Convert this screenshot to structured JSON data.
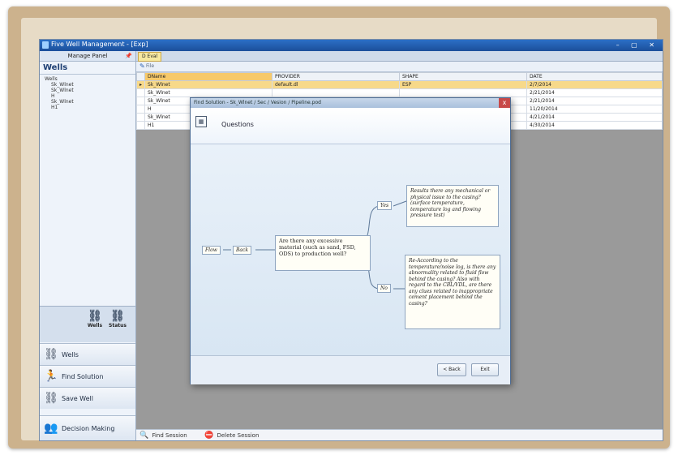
{
  "window": {
    "title": "Five Well Management - [Exp]"
  },
  "left_pane": {
    "header": "Manage Panel",
    "title": "Wells",
    "tree": [
      "Wells",
      "Sk_Wlnet",
      "Sk_Wlnet",
      "H",
      "Sk_Wlnet",
      "H1"
    ],
    "ribbon": [
      {
        "label": "Wells"
      },
      {
        "label": "Status"
      }
    ],
    "nav": [
      {
        "label": "Wells"
      },
      {
        "label": "Find Solution"
      },
      {
        "label": "Save Well"
      },
      {
        "label": "Decision Making"
      }
    ]
  },
  "tabs": [
    {
      "label": "D Eval"
    }
  ],
  "toolbar": {
    "label": "File"
  },
  "grid": {
    "columns": [
      "DName",
      "PROVIDER",
      "SHAPE",
      "DATE"
    ],
    "rows": [
      [
        "Sk_Wlnet",
        "default.dl",
        "ESP",
        "2/7/2014"
      ],
      [
        "Sk_Wlnet",
        "",
        "",
        "2/21/2014"
      ],
      [
        "Sk_Wlnet",
        "",
        "",
        "2/21/2014"
      ],
      [
        "H",
        "",
        "",
        "11/20/2014"
      ],
      [
        "Sk_Wlnet",
        "",
        "",
        "4/21/2014"
      ],
      [
        "H1",
        "",
        "",
        "4/30/2014"
      ]
    ]
  },
  "status_bar": {
    "find_session": "Find Session",
    "delete_session": "Delete Session"
  },
  "dialog": {
    "title": "Find Solution - Sk_Wlnet / Sec / Vesion / Pipeline.pod",
    "close": "x",
    "heading": "Questions",
    "nodes": {
      "start": "Flow",
      "node2": "Back",
      "question": "Are there any excessive material (such as sand, FSD, ODS) to production well?",
      "yes": "Yes",
      "no": "No",
      "yes_answer": "Results there any mechanical or physical issue to the casing? (surface temperature, temperature log and flowing pressure test)",
      "no_answer": "Re-According to the temperature/noise log, is there any abnormality related to fluid flow behind the casing? Also with regard to the CBL/VDL, are there any clues related to inappropriate cement placement behind the casing?"
    },
    "buttons": {
      "back": "< Back",
      "exit": "Exit"
    }
  }
}
